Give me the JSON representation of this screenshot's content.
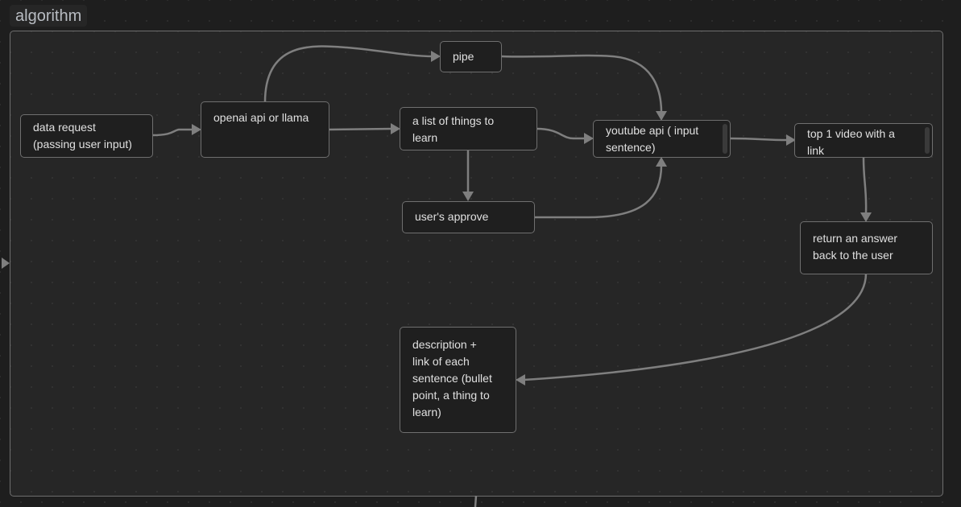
{
  "canvas": {
    "group": {
      "label": "algorithm"
    },
    "nodes": [
      {
        "id": "data-request",
        "text": "data request\n(passing user input)"
      },
      {
        "id": "openai-api",
        "text": "openai api or llama"
      },
      {
        "id": "pipe",
        "text": "pipe"
      },
      {
        "id": "list-of-things",
        "text": "a list of things to\nlearn"
      },
      {
        "id": "users-approve",
        "text": "user's approve"
      },
      {
        "id": "youtube-api",
        "text": "youtube api ( input\nsentence)"
      },
      {
        "id": "top-video",
        "text": "top 1 video with a\nlink"
      },
      {
        "id": "return-answer",
        "text": "return an answer\nback to the user"
      },
      {
        "id": "description",
        "text": "description +\nlink of each\nsentence (bullet\npoint, a thing to\nlearn)"
      }
    ],
    "edges": [
      {
        "from": "data-request",
        "to": "openai-api"
      },
      {
        "from": "openai-api",
        "to": "pipe"
      },
      {
        "from": "openai-api",
        "to": "list-of-things"
      },
      {
        "from": "pipe",
        "to": "youtube-api"
      },
      {
        "from": "list-of-things",
        "to": "youtube-api"
      },
      {
        "from": "list-of-things",
        "to": "users-approve"
      },
      {
        "from": "users-approve",
        "to": "youtube-api"
      },
      {
        "from": "youtube-api",
        "to": "top-video"
      },
      {
        "from": "top-video",
        "to": "return-answer"
      },
      {
        "from": "return-answer",
        "to": "description"
      }
    ],
    "colors": {
      "background": "#1e1e1e",
      "group_fill": "#262626",
      "node_fill": "#1f1f1f",
      "edge": "#7f7f7f",
      "text": "#e0e0e0"
    }
  }
}
